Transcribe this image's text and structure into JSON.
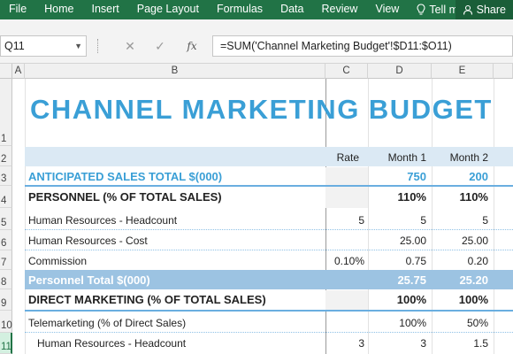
{
  "ribbon": {
    "tabs": [
      "File",
      "Home",
      "Insert",
      "Page Layout",
      "Formulas",
      "Data",
      "Review",
      "View"
    ],
    "tell_me": "Tell me",
    "share": "Share"
  },
  "formula_bar": {
    "name_box": "Q11",
    "fx_label": "fx",
    "formula": "=SUM('Channel Marketing Budget'!$D11:$O11)"
  },
  "columns": [
    "A",
    "B",
    "C",
    "D",
    "E"
  ],
  "rows": [
    "1",
    "2",
    "3",
    "4",
    "5",
    "6",
    "7",
    "8",
    "9",
    "10",
    "11"
  ],
  "sheet": {
    "title": "CHANNEL MARKETING BUDGET",
    "headers": {
      "rate": "Rate",
      "month1": "Month 1",
      "month2": "Month 2"
    },
    "anticipated": {
      "label": "ANTICIPATED SALES TOTAL $(000)",
      "m1": "750",
      "m2": "200"
    },
    "personnel": {
      "label": "PERSONNEL (% OF TOTAL SALES)",
      "m1": "110%",
      "m2": "110%"
    },
    "hr_headcount": {
      "label": "Human Resources - Headcount",
      "rate": "5",
      "m1": "5",
      "m2": "5"
    },
    "hr_cost": {
      "label": "Human Resources - Cost",
      "m1": "25.00",
      "m2": "25.00"
    },
    "commission": {
      "label": "Commission",
      "rate": "0.10%",
      "m1": "0.75",
      "m2": "0.20"
    },
    "personnel_total": {
      "label": "Personnel Total $(000)",
      "m1": "25.75",
      "m2": "25.20"
    },
    "direct": {
      "label": "DIRECT MARKETING (% OF TOTAL SALES)",
      "m1": "100%",
      "m2": "100%"
    },
    "telemarketing": {
      "label": "Telemarketing (% of Direct Sales)",
      "m1": "100%",
      "m2": "50%"
    },
    "hr_headcount2": {
      "label": "Human Resources - Headcount",
      "rate": "3",
      "m1": "3",
      "m2": "1.5"
    }
  },
  "colors": {
    "ribbon": "#217346",
    "title": "#3a9fd6",
    "band_blue": "#9cc3e2",
    "band_light": "#dbe9f4"
  }
}
